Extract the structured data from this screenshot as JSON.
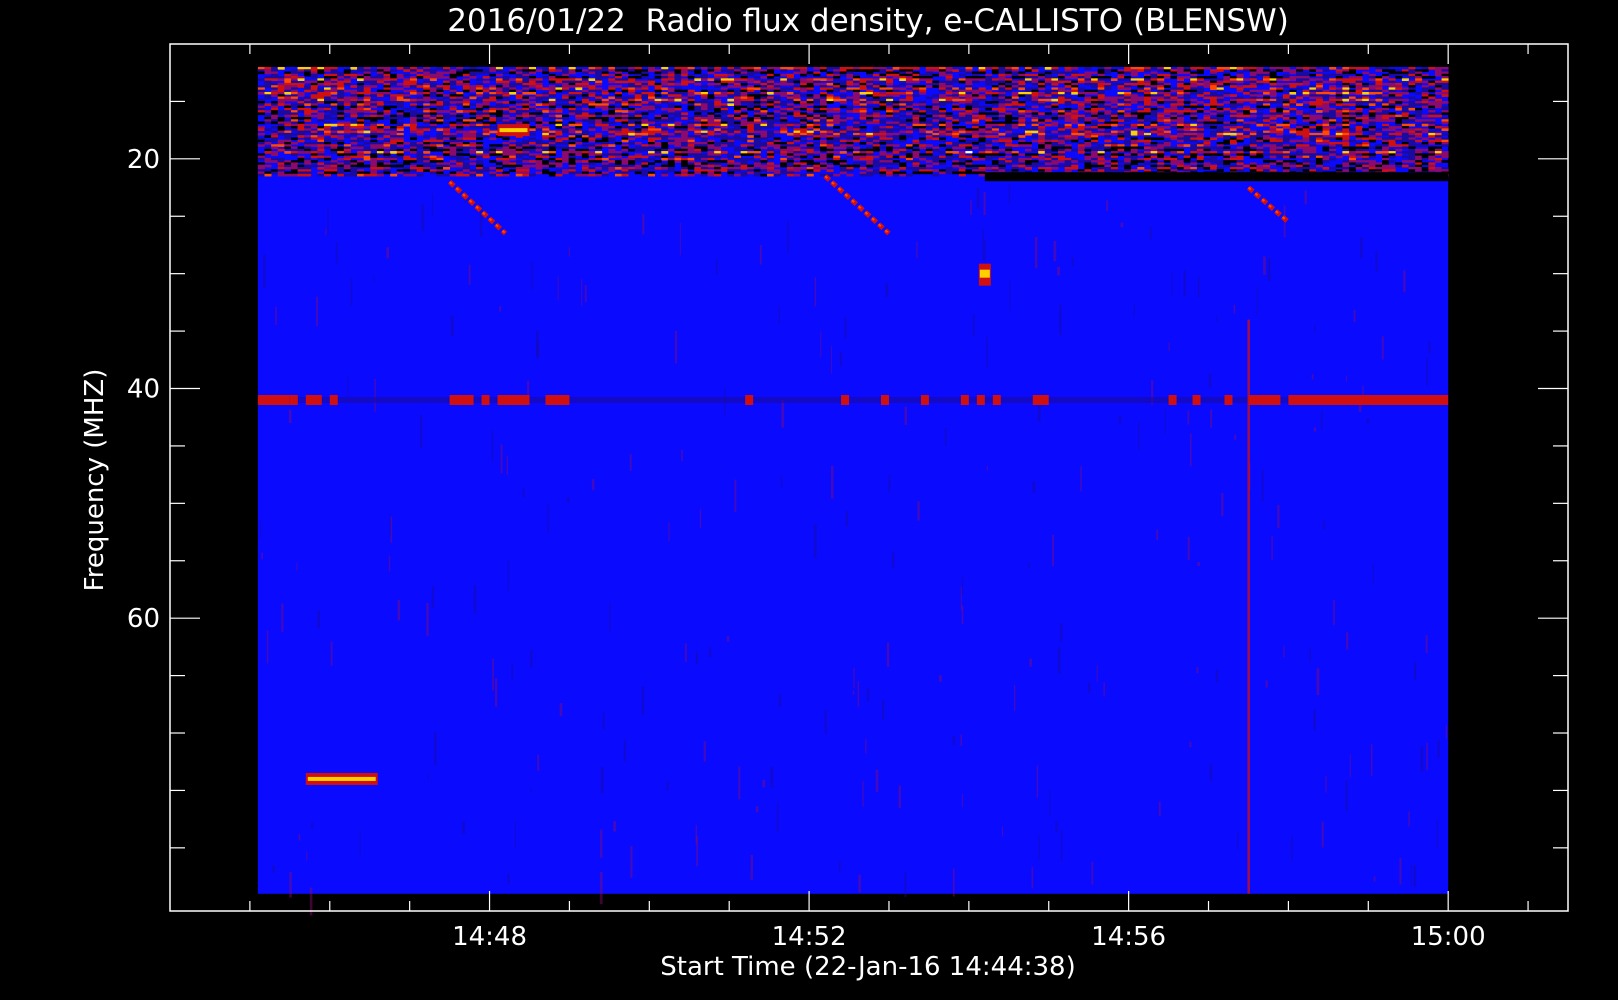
{
  "chart_data": {
    "type": "heatmap",
    "title": "2016/01/22  Radio flux density, e-CALLISTO (BLENSW)",
    "xlabel": "Start Time (22-Jan-16 14:44:38)",
    "ylabel": "Frequency (MHZ)",
    "x_axis": {
      "unit": "minutes after 14:44",
      "range": [
        44.0,
        61.5
      ],
      "data_range": [
        45.1,
        60.0
      ],
      "major_ticks": [
        {
          "value": 48,
          "label": "14:48"
        },
        {
          "value": 52,
          "label": "14:52"
        },
        {
          "value": 56,
          "label": "14:56"
        },
        {
          "value": 60,
          "label": "15:00"
        }
      ],
      "minor_step": 1
    },
    "y_axis": {
      "unit": "MHz",
      "range": [
        10.0,
        85.5
      ],
      "inverted": true,
      "data_range": [
        12.0,
        84.0
      ],
      "major_ticks": [
        {
          "value": 20,
          "label": "20"
        },
        {
          "value": 40,
          "label": "40"
        },
        {
          "value": 60,
          "label": "60"
        }
      ],
      "minor_step": 5
    },
    "background_level_color": "#0a0aff",
    "colormap": [
      "#000000",
      "#1a0aa0",
      "#0a0aff",
      "#8a0a6e",
      "#d01010",
      "#ff4a00",
      "#ffd000",
      "#ffffff"
    ],
    "features": [
      {
        "type": "noise_band",
        "y_range": [
          12.0,
          21.5
        ],
        "description": "strong interference"
      },
      {
        "type": "dark_line",
        "y": 21.6,
        "x_range": [
          54.2,
          60.0
        ]
      },
      {
        "type": "dashed_line",
        "y": 41.0,
        "segments": [
          [
            45.1,
            45.5
          ],
          [
            45.5,
            45.6
          ],
          [
            45.7,
            45.9
          ],
          [
            46.0,
            46.1
          ],
          [
            47.5,
            47.8
          ],
          [
            47.9,
            48.0
          ],
          [
            48.1,
            48.5
          ],
          [
            48.7,
            49.0
          ],
          [
            51.2,
            51.3
          ],
          [
            52.4,
            52.5
          ],
          [
            52.9,
            53.0
          ],
          [
            53.4,
            53.5
          ],
          [
            53.9,
            54.0
          ],
          [
            54.1,
            54.2
          ],
          [
            54.3,
            54.4
          ],
          [
            54.8,
            55.0
          ],
          [
            56.5,
            56.6
          ],
          [
            56.8,
            56.9
          ],
          [
            57.2,
            57.3
          ],
          [
            57.5,
            57.9
          ],
          [
            58.0,
            60.0
          ]
        ]
      },
      {
        "type": "drift_burst",
        "points": [
          [
            47.5,
            22.0
          ],
          [
            48.2,
            26.5
          ]
        ]
      },
      {
        "type": "drift_burst",
        "points": [
          [
            52.2,
            21.5
          ],
          [
            53.0,
            26.5
          ]
        ]
      },
      {
        "type": "drift_burst",
        "points": [
          [
            57.5,
            22.5
          ],
          [
            58.0,
            25.5
          ]
        ]
      },
      {
        "type": "spot",
        "x": 54.2,
        "y": 30.0
      },
      {
        "type": "bar",
        "y": 74.0,
        "x_range": [
          45.7,
          46.6
        ]
      },
      {
        "type": "bar",
        "y": 17.5,
        "x_range": [
          48.1,
          48.5
        ]
      },
      {
        "type": "vertical_line",
        "x": 57.5,
        "y_range": [
          34.0,
          84.0
        ]
      }
    ]
  }
}
